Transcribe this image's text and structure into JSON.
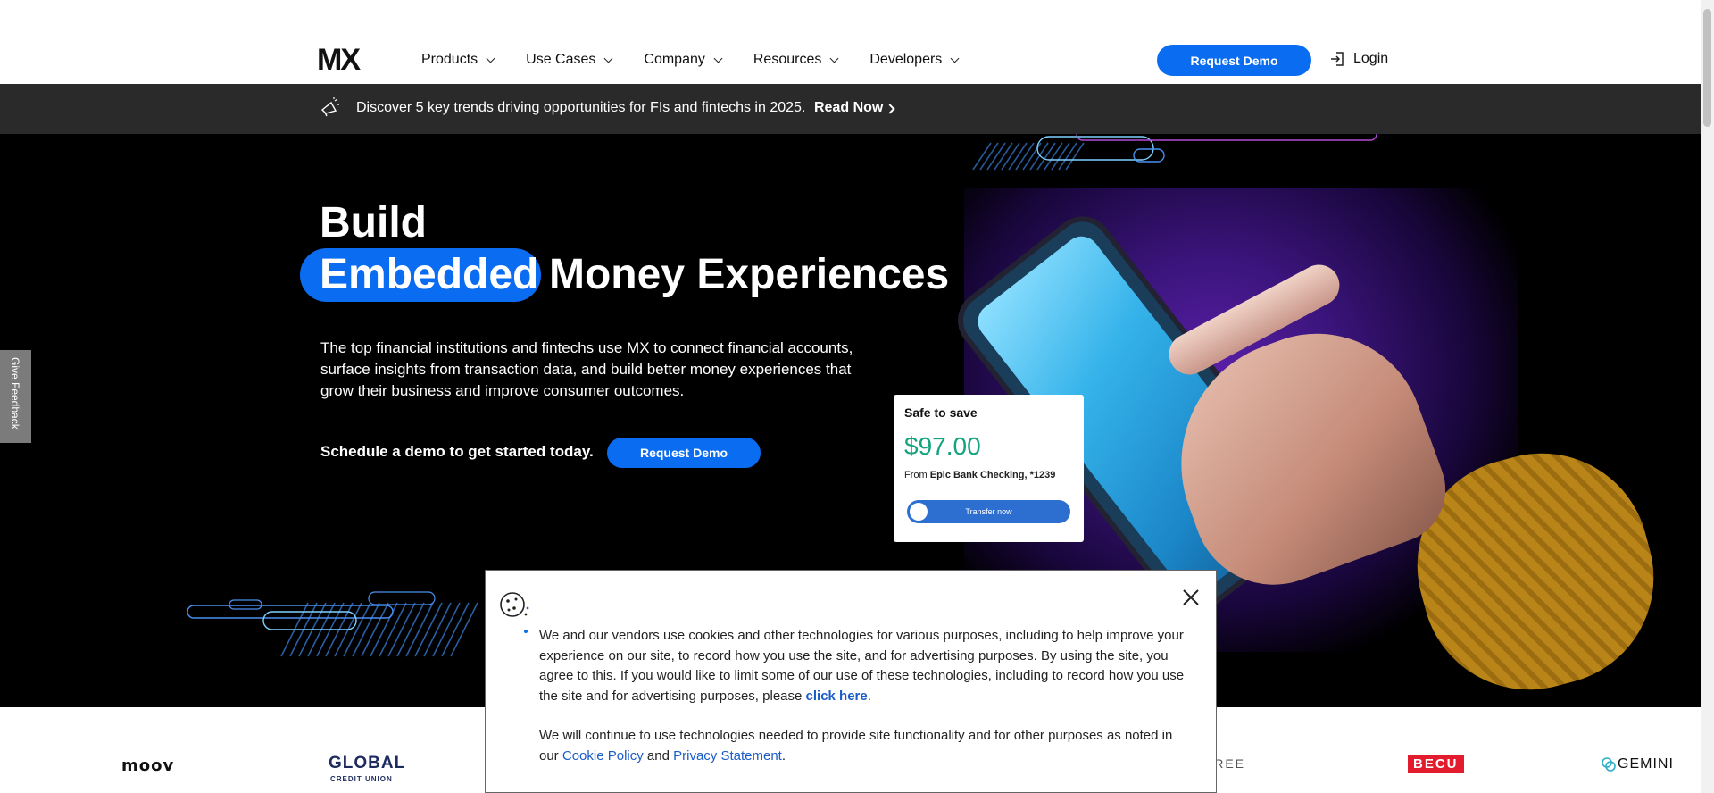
{
  "header": {
    "logo": "MX",
    "nav": [
      {
        "label": "Products"
      },
      {
        "label": "Use Cases"
      },
      {
        "label": "Company"
      },
      {
        "label": "Resources"
      },
      {
        "label": "Developers"
      }
    ],
    "request_demo_label": "Request Demo",
    "login_label": "Login"
  },
  "announcement": {
    "text": "Discover 5 key trends driving opportunities for FIs and fintechs in 2025.",
    "link_label": "Read Now",
    "icon": "megaphone-icon"
  },
  "hero": {
    "title_line1": "Build",
    "title_highlight": "Embedded",
    "title_rest": "Money Experiences",
    "description": "The top financial institutions and fintechs use MX to connect financial accounts, surface insights from transaction data, and build better money experiences that grow their business and improve consumer outcomes.",
    "cta_text": "Schedule a demo to get started today.",
    "cta_button": "Request Demo",
    "accent_color": "#0a6cf0"
  },
  "save_card": {
    "title": "Safe to save",
    "amount": "$97.00",
    "from_label": "From",
    "account": "Epic Bank Checking, *1239",
    "button_label": "Transfer now"
  },
  "cookie": {
    "icon": "cookie-icon",
    "p1_text": "We and our vendors use cookies and other technologies for various purposes, including to help improve your experience on our site, to record how you use the site, and for advertising purposes. By using the site, you agree to this. If you would like to limit some of our use of these technologies, including to record how you use the site and for advertising purposes, please ",
    "p1_link": "click here",
    "p1_end": ".",
    "p2_text": "We will continue to use technologies needed to provide site functionality and for other purposes as noted in our ",
    "cookie_policy": "Cookie Policy",
    "and": " and ",
    "privacy": "Privacy Statement",
    "p2_end": "."
  },
  "logos": {
    "moov": "moov",
    "global": "GLOBAL",
    "global_sub": "CREDIT UNION",
    "mfree": "MFREE",
    "becu": "BECU",
    "gemini": "GEMINI"
  },
  "feedback": {
    "label": "Give Feedback"
  }
}
